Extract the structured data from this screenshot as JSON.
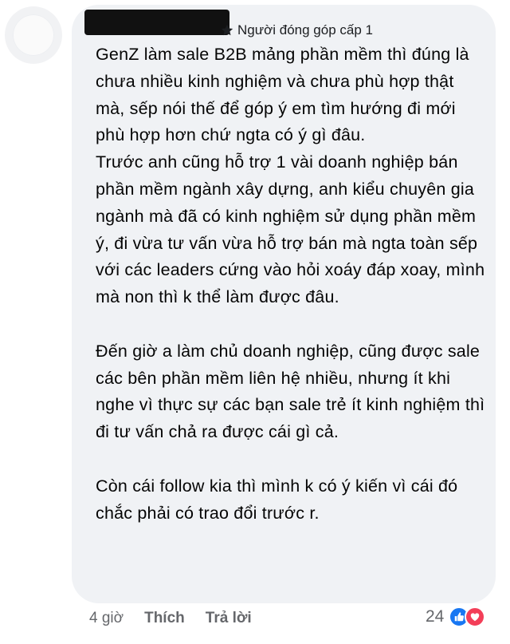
{
  "comment": {
    "badge_label": "Người đóng góp cấp 1",
    "paragraphs": [
      "GenZ làm sale B2B mảng phần mềm thì đúng là chưa nhiều kinh nghiệm và chưa phù hợp thật mà, sếp nói thế để góp ý em tìm hướng đi mới phù hợp hơn chứ ngta có ý gì đâu.",
      "Trước anh cũng hỗ trợ 1 vài doanh nghiệp bán phần mềm ngành xây dựng, anh kiểu chuyên gia ngành mà đã có kinh nghiệm sử dụng phần mềm ý, đi vừa tư vấn vừa hỗ trợ bán mà ngta toàn sếp với các leaders cứng vào hỏi xoáy đáp xoay, mình mà non thì k thể làm được đâu.",
      "Đến giờ a làm chủ doanh nghiệp, cũng được sale các bên phần mềm liên hệ nhiều, nhưng ít khi nghe vì thực sự các bạn sale trẻ ít kinh nghiệm thì đi tư vấn chả ra được cái gì cả.",
      "Còn cái follow kia thì mình k có ý kiến vì cái đó chắc phải có trao đổi trước r."
    ]
  },
  "footer": {
    "time": "4 giờ",
    "like_label": "Thích",
    "reply_label": "Trả lời"
  },
  "reactions": {
    "count": "24",
    "icons": [
      "like-icon",
      "love-icon"
    ]
  },
  "colors": {
    "bubble": "#f0f2f5",
    "meta_text": "#65676b",
    "like": "#1877f2",
    "love": "#f33e58"
  }
}
